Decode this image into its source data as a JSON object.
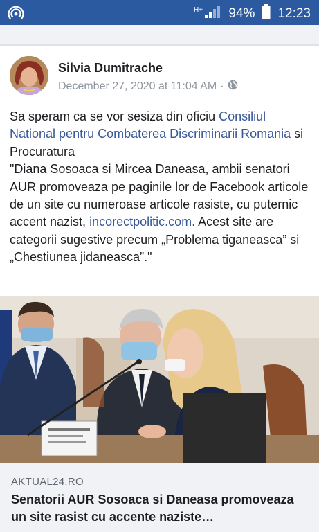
{
  "status_bar": {
    "battery": "94%",
    "time": "12:23",
    "network_type": "H+",
    "icons": [
      "hotspot-icon",
      "signal-icon",
      "battery-icon"
    ]
  },
  "post": {
    "author": "Silvia Dumitrache",
    "timestamp": "December 27, 2020 at 11:04 AM",
    "separator": "·",
    "audience_icon": "globe-icon",
    "text": {
      "p1_before": "Sa speram ca se vor sesiza din oficiu ",
      "p1_link": "Consiliul National pentru Combaterea Discriminarii Romania",
      "p1_after": " si Procuratura",
      "p2_before": "\"Diana Sosoaca si Mircea Daneasa, ambii senatori AUR promoveaza pe paginile lor de Facebook articole de un site cu numeroase articole rasiste, cu puternic accent nazist, ",
      "p2_link": "incorectpolitic.com.",
      "p2_after": " Acest site are categorii sugestive precum „Problema tiganeasca” si „Chestiunea jidaneasca”.\""
    }
  },
  "link_preview": {
    "domain": "AKTUAL24.RO",
    "title": "Senatorii AUR Sosoaca si Daneasa promoveaza un site rasist cu accente naziste…"
  },
  "colors": {
    "status_bar_bg": "#2c5aa0",
    "link": "#385898",
    "card_bg": "#f0f2f5"
  }
}
